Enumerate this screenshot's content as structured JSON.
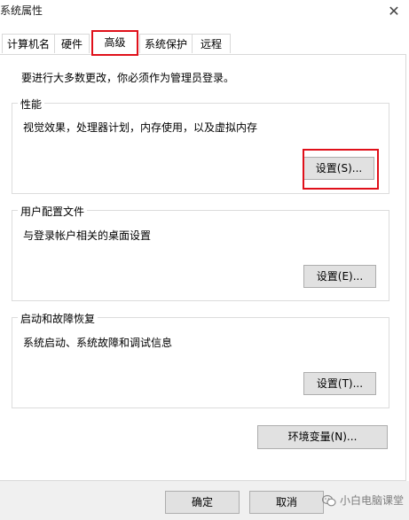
{
  "window": {
    "title": "系统属性"
  },
  "tabs": [
    {
      "label": "计算机名"
    },
    {
      "label": "硬件"
    },
    {
      "label": "高级"
    },
    {
      "label": "系统保护"
    },
    {
      "label": "远程"
    }
  ],
  "intro": "要进行大多数更改，你必须作为管理员登录。",
  "performance": {
    "title": "性能",
    "desc": "视觉效果，处理器计划，内存使用，以及虚拟内存",
    "button": "设置(S)..."
  },
  "profiles": {
    "title": "用户配置文件",
    "desc": "与登录帐户相关的桌面设置",
    "button": "设置(E)..."
  },
  "startup": {
    "title": "启动和故障恢复",
    "desc": "系统启动、系统故障和调试信息",
    "button": "设置(T)..."
  },
  "env_button": "环境变量(N)...",
  "footer": {
    "ok": "确定",
    "cancel": "取消"
  },
  "watermark": "小白电脑课堂",
  "colors": {
    "highlight": "#e0101a",
    "button_bg": "#e1e1e1",
    "footer_bg": "#f0f0f0"
  }
}
